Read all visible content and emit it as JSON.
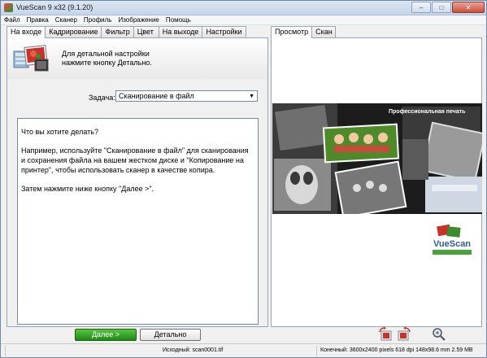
{
  "window": {
    "title": "VueScan 9 x32 (9.1.20)"
  },
  "menu": [
    "Файл",
    "Правка",
    "Сканер",
    "Профиль",
    "Изображение",
    "Помощь"
  ],
  "left_tabs": [
    "На входе",
    "Кадрирование",
    "Фильтр",
    "Цвет",
    "На выходе",
    "Настройки"
  ],
  "intro": {
    "line1": "Для детальной настройки",
    "line2": "нажмите кнопку Детально."
  },
  "task": {
    "label": "Задача:",
    "value": "Сканирование в файл"
  },
  "help": {
    "p1": "Что вы хотите делать?",
    "p2": "Например, используйте \"Сканирование в файл\" для сканирования и сохранения файла на вашем жестком диске и \"Копирование на принтер\", чтобы использовать сканер в качестве копира.",
    "p3": "Затем нажмите ниже кнопку \"Далее >\"."
  },
  "right_tabs": [
    "Просмотр",
    "Скан"
  ],
  "preview": {
    "caption": "Профессиональная печать"
  },
  "buttons": {
    "next": "Далее >",
    "detail": "Детально"
  },
  "status": {
    "source": "Исходный: scan0001.tif",
    "output": "Конечный: 3600x2400 pixels 618 dpi 148x98.6 mm 2.59 MB"
  },
  "colors": {
    "next_button": "#2b9a20",
    "titlebar": "#c5d6ea",
    "close_button": "#c8503c"
  }
}
